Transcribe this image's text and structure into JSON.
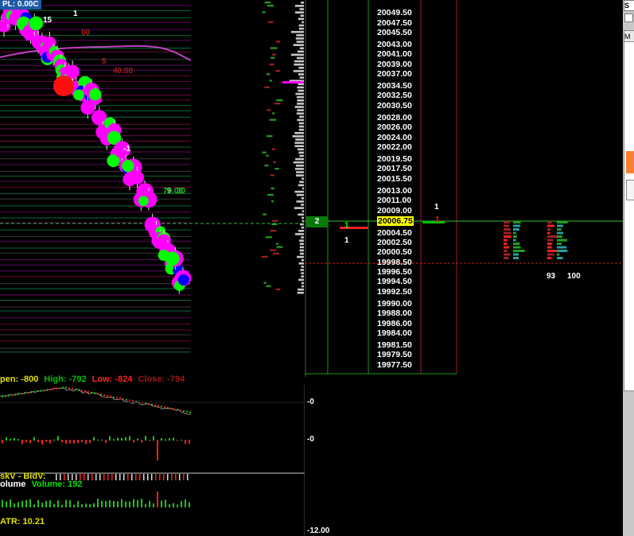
{
  "left_chart": {
    "pl_label": "PL: 0.00C",
    "ohlc": {
      "open_label": "pen:",
      "open_value": "-800",
      "high_label": "High:",
      "high_value": "-792",
      "low_label": "Low:",
      "low_value": "-824",
      "close_label": "Close:",
      "close_value": "-794"
    },
    "askbid_label": "skV - BidV:",
    "volume_title": "olume",
    "volume_label": "Volume:",
    "volume_value": "192",
    "atr_label": "ATR:",
    "atr_value": "10.21",
    "axis_labels": [
      "-0",
      "-0",
      "-12.00"
    ],
    "chart_marks": [
      "15",
      "1",
      "00",
      "5",
      "40.00",
      "9",
      "-1",
      "70.00",
      "00"
    ]
  },
  "dom": {
    "prices": [
      "20049.50",
      "20047.50",
      "20045.50",
      "20043.00",
      "20041.00",
      "20039.00",
      "20037.00",
      "20034.50",
      "20032.50",
      "20030.50",
      "20028.00",
      "20026.00",
      "20024.00",
      "20022.00",
      "20019.50",
      "20017.50",
      "20015.50",
      "20013.00",
      "20011.00",
      "20009.00",
      "20006.75",
      "20004.50",
      "20002.50",
      "20000.50",
      "19998.50",
      "19996.50",
      "19994.50",
      "19992.50",
      "19990.00",
      "19988.00",
      "19986.00",
      "19984.00",
      "19981.50",
      "19979.50",
      "19977.50"
    ],
    "current_price": "20006.75",
    "position_qty": "2",
    "bid_size": "1",
    "bid_count": "1",
    "ask_size": "1",
    "ask_count": "1",
    "cluster_left_total": "93",
    "cluster_right_total": "100"
  },
  "right_panel": {
    "top_label": "S",
    "tab_label": "M"
  },
  "colors": {
    "magenta": "#ff00ff",
    "green": "#00ff00",
    "blue": "#0000ff",
    "red": "#ff0000",
    "highlight": "#ffff00",
    "dark_green": "#0a7a0a",
    "dark_red": "#8b0000"
  }
}
